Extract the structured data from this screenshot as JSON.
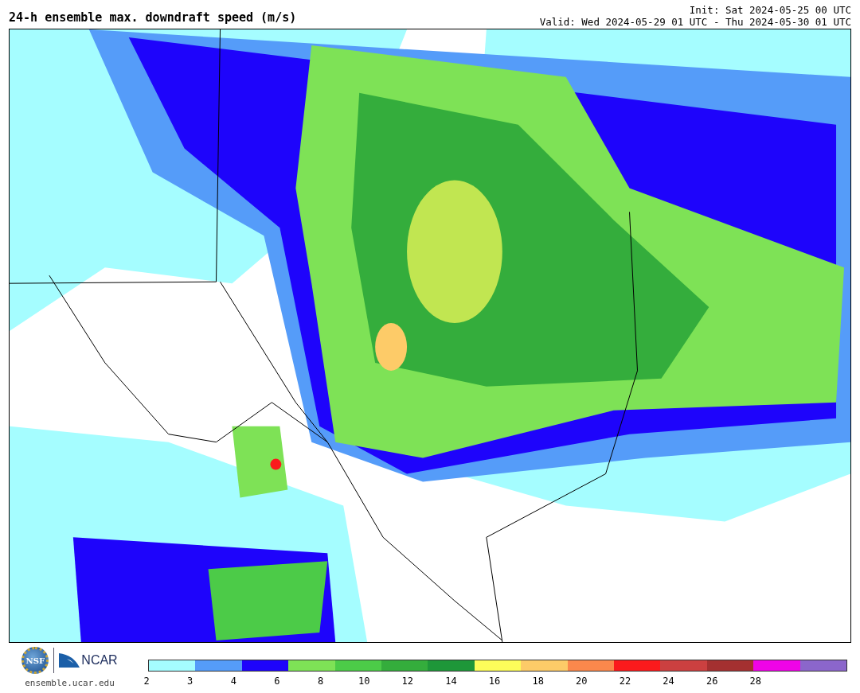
{
  "title": "24-h ensemble max. downdraft speed (m/s)",
  "init": "Init: Sat 2024-05-25 00 UTC",
  "valid": "Valid: Wed 2024-05-29 01 UTC - Thu 2024-05-30 01 UTC",
  "logos": {
    "nsf": "NSF",
    "ncar": "NCAR",
    "url": "ensemble.ucar.edu"
  },
  "colorbar": {
    "segments": [
      {
        "color": "#a5fdff"
      },
      {
        "color": "#559cf9"
      },
      {
        "color": "#1e04fb"
      },
      {
        "color": "#7ee256"
      },
      {
        "color": "#4ccb48"
      },
      {
        "color": "#34ad3c"
      },
      {
        "color": "#1e9739"
      },
      {
        "color": "#fdfd5a"
      },
      {
        "color": "#fdcb68"
      },
      {
        "color": "#fb884c"
      },
      {
        "color": "#fb1a1c"
      },
      {
        "color": "#cb4040"
      },
      {
        "color": "#a43030"
      },
      {
        "color": "#ef04e7"
      },
      {
        "color": "#8b66cb"
      }
    ],
    "ticks": [
      "2",
      "3",
      "4",
      "6",
      "8",
      "10",
      "12",
      "14",
      "16",
      "18",
      "20",
      "22",
      "24",
      "26",
      "28"
    ]
  }
}
